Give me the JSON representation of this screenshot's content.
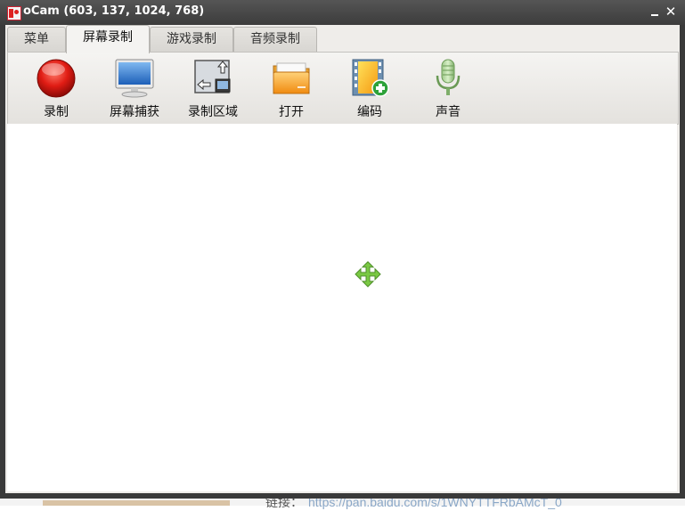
{
  "window": {
    "title": "oCam (603, 137, 1024, 768)",
    "close_glyph": "✕"
  },
  "tabs": [
    {
      "label": "菜单"
    },
    {
      "label": "屏幕录制"
    },
    {
      "label": "游戏录制"
    },
    {
      "label": "音频录制"
    }
  ],
  "active_tab": "屏幕录制",
  "toolbar": {
    "items": [
      {
        "label": "录制",
        "icon": "record-icon"
      },
      {
        "label": "屏幕捕获",
        "icon": "monitor-icon"
      },
      {
        "label": "录制区域",
        "icon": "resize-area-icon"
      },
      {
        "label": "打开",
        "icon": "folder-icon"
      },
      {
        "label": "编码",
        "icon": "film-add-icon"
      },
      {
        "label": "声音",
        "icon": "microphone-icon"
      }
    ]
  },
  "canvas": {
    "cursor_icon": "move-cursor-icon"
  },
  "background": {
    "label": "链接：",
    "link_text": "https://pan.baidu.com/s/1WNYTTFRbAMcT_0"
  },
  "colors": {
    "title_bar": "#3c3c3c",
    "record_red": "#d81818",
    "cursor_green": "#7ac943"
  }
}
